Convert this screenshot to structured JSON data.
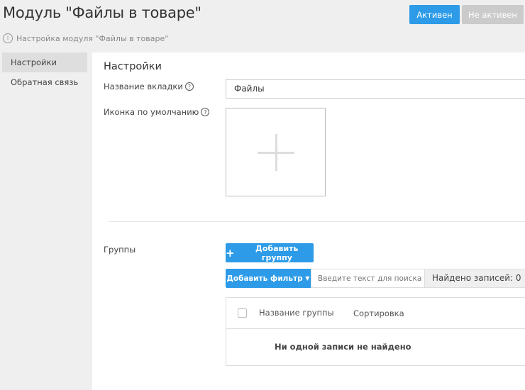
{
  "header": {
    "title": "Модуль \"Файлы в товаре\"",
    "subtitle": "Настройка модуля \"Файлы в товаре\"",
    "active_label": "Активен",
    "inactive_label": "Не активен"
  },
  "sidebar": {
    "items": [
      {
        "label": "Настройки",
        "active": true
      },
      {
        "label": "Обратная связь",
        "active": false
      }
    ]
  },
  "main": {
    "section_title": "Настройки",
    "tab_name_label": "Название вкладки",
    "tab_name_value": "Файлы",
    "icon_label": "Иконка по умолчанию",
    "groups_label": "Группы",
    "add_group_label": "Добавить группу",
    "add_filter_label": "Добавить фильтр",
    "search_placeholder": "Введите текст для поиска",
    "found_label": "Найдено записей: 0",
    "columns": [
      "Название группы",
      "Сортировка"
    ],
    "empty_text": "Ни одной записи не найдено"
  },
  "colors": {
    "primary": "#2d9be8",
    "inactive": "#cccccc"
  }
}
